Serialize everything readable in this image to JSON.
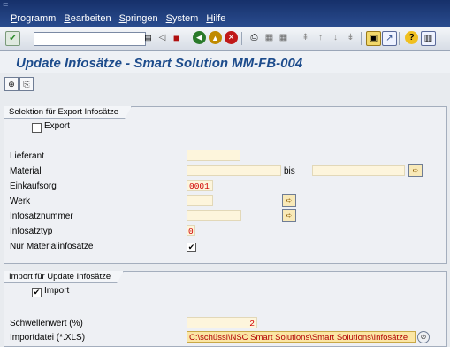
{
  "menu": [
    "Programm",
    "Bearbeiten",
    "Springen",
    "System",
    "Hilfe"
  ],
  "toolbar": {
    "command_value": "",
    "icons": [
      "enter-icon",
      "history-icon",
      "back-arrow-icon",
      "save-icon",
      "back-icon",
      "exit-icon",
      "cancel-icon",
      "print-icon",
      "find-icon",
      "find-next-icon",
      "first-page-icon",
      "prev-page-icon",
      "next-page-icon",
      "last-page-icon",
      "new-session-icon",
      "shortcut-icon",
      "help-icon",
      "layout-icon"
    ]
  },
  "title": "Update Infosätze  - Smart Solution MM-FB-004",
  "app_toolbar": [
    "execute-icon",
    "variant-icon"
  ],
  "export_section": {
    "caption": "Selektion für Export Infosätze",
    "export_label": "Export",
    "export_checked": false,
    "fields": {
      "lieferant": {
        "label": "Lieferant",
        "value": ""
      },
      "material": {
        "label": "Material",
        "value": "",
        "bis_label": "bis",
        "bis_value": ""
      },
      "einkaufsorg": {
        "label": "Einkaufsorg",
        "value": "0001"
      },
      "werk": {
        "label": "Werk",
        "value": ""
      },
      "infosatznummer": {
        "label": "Infosatznummer",
        "value": ""
      },
      "infosatztyp": {
        "label": "Infosatztyp",
        "value": "0"
      },
      "nur_material": {
        "label": "Nur Materialinfosätze",
        "checked": true
      }
    }
  },
  "import_section": {
    "caption": "Import für Update Infosätze",
    "import_label": "Import",
    "import_checked": true,
    "schwellenwert": {
      "label": "Schwellenwert (%)",
      "value": "2"
    },
    "importdatei": {
      "label": "Importdatei (*.XLS)",
      "value": "C:\\schüssl\\NSC Smart Solutions\\Smart Solutions\\Infosätze"
    }
  }
}
